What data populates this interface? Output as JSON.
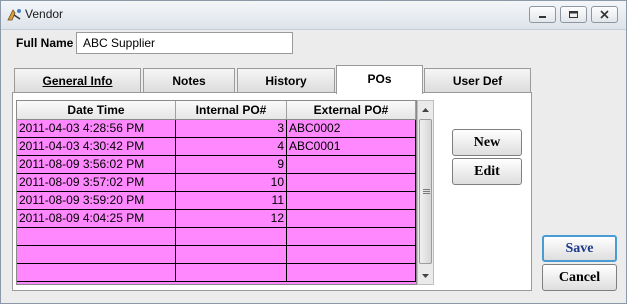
{
  "window": {
    "title": "Vendor",
    "icon": "vendor-app-icon",
    "controls": [
      "minimize-icon",
      "maximize-icon",
      "close-icon"
    ]
  },
  "form": {
    "full_name_label": "Full Name",
    "full_name_value": "ABC Supplier"
  },
  "tabs": [
    {
      "label": "General Info",
      "active": false
    },
    {
      "label": "Notes",
      "active": false
    },
    {
      "label": "History",
      "active": false
    },
    {
      "label": "POs",
      "active": true
    },
    {
      "label": "User Def",
      "active": false
    }
  ],
  "pos_table": {
    "columns": [
      "Date Time",
      "Internal PO#",
      "External PO#"
    ],
    "rows": [
      {
        "date_time": "2011-04-03 4:28:56 PM",
        "internal_po": "3",
        "external_po": "ABC0002"
      },
      {
        "date_time": "2011-04-03 4:30:42 PM",
        "internal_po": "4",
        "external_po": "ABC0001"
      },
      {
        "date_time": "2011-08-09 3:56:02 PM",
        "internal_po": "9",
        "external_po": ""
      },
      {
        "date_time": "2011-08-09 3:57:02 PM",
        "internal_po": "10",
        "external_po": ""
      },
      {
        "date_time": "2011-08-09 3:59:20 PM",
        "internal_po": "11",
        "external_po": ""
      },
      {
        "date_time": "2011-08-09 4:04:25 PM",
        "internal_po": "12",
        "external_po": ""
      },
      {
        "date_time": "",
        "internal_po": "",
        "external_po": ""
      },
      {
        "date_time": "",
        "internal_po": "",
        "external_po": ""
      },
      {
        "date_time": "",
        "internal_po": "",
        "external_po": ""
      }
    ],
    "row_color": "#ff88ff"
  },
  "buttons": {
    "new": "New",
    "edit": "Edit",
    "save": "Save",
    "cancel": "Cancel"
  },
  "colors": {
    "row_highlight": "#ff88ff",
    "default_button_border": "#4a9bd4",
    "save_text": "#1c3a8c"
  }
}
